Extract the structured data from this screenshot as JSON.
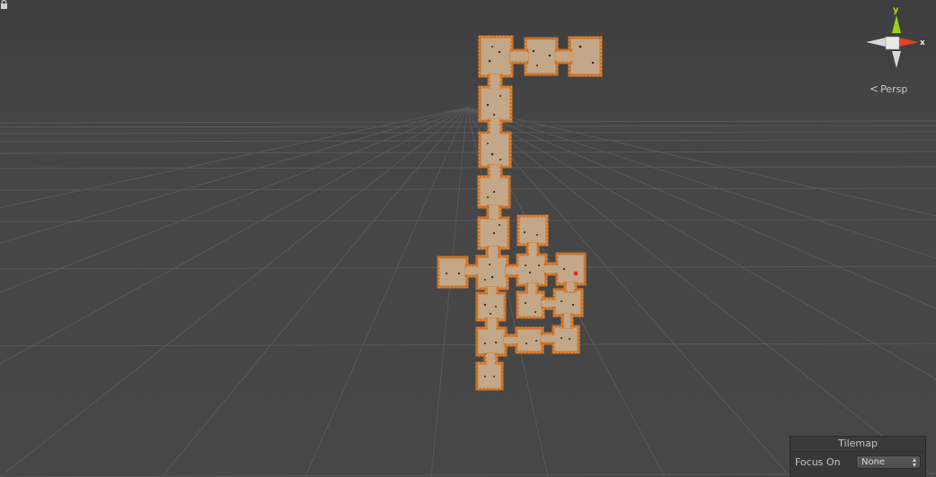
{
  "viewport": {
    "projection_label": "Persp",
    "axis_x_label": "x",
    "axis_y_label": "y",
    "lock_icon": "lock-icon"
  },
  "tilemap_panel": {
    "title": "Tilemap",
    "focus_label": "Focus On",
    "focus_value": "None"
  },
  "colors": {
    "background": "#474747",
    "grid": "#5a5a5a",
    "floor": "#c3a98a",
    "wall": "#d47a2d",
    "axis_x": "#e8442a",
    "axis_y": "#a5d422",
    "marker": "#e62020"
  }
}
